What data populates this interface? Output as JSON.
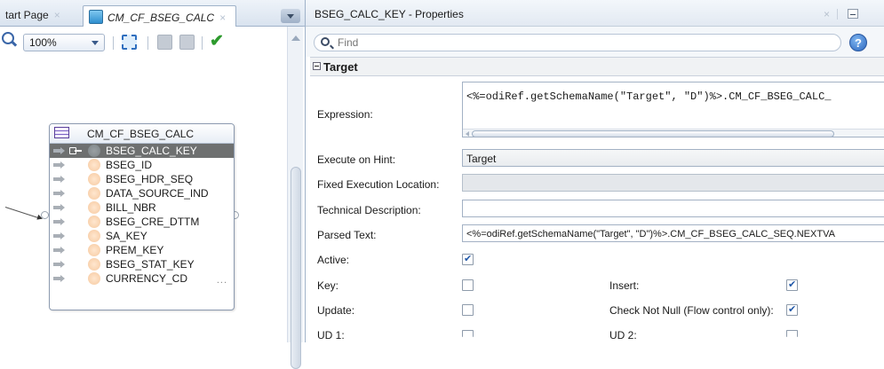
{
  "diagram_tabs": [
    {
      "label": "tart Page",
      "close": "×"
    },
    {
      "label": "CM_CF_BSEG_CALC",
      "close": "×"
    }
  ],
  "toolbar": {
    "zoom": "100%"
  },
  "entity": {
    "title": "CM_CF_BSEG_CALC",
    "attributes": [
      {
        "name": "BSEG_CALC_KEY",
        "selected": true
      },
      {
        "name": "BSEG_ID"
      },
      {
        "name": "BSEG_HDR_SEQ"
      },
      {
        "name": "DATA_SOURCE_IND"
      },
      {
        "name": "BILL_NBR"
      },
      {
        "name": "BSEG_CRE_DTTM"
      },
      {
        "name": "SA_KEY"
      },
      {
        "name": "PREM_KEY"
      },
      {
        "name": "BSEG_STAT_KEY"
      },
      {
        "name": "CURRENCY_CD"
      }
    ],
    "more": "..."
  },
  "properties": {
    "title": "BSEG_CALC_KEY - Properties",
    "close": "×",
    "find_placeholder": "Find",
    "help": "?",
    "section": "Target",
    "expression_label": "Expression:",
    "expression": "<%=odiRef.getSchemaName(\"Target\", \"D\")%>.CM_CF_BSEG_CALC_",
    "execute_on_hint_label": "Execute on Hint:",
    "execute_on_hint": "Target",
    "fixed_exec_label": "Fixed Execution Location:",
    "fixed_exec": "",
    "tech_desc_label": "Technical Description:",
    "tech_desc": "",
    "parsed_text_label": "Parsed Text:",
    "parsed_text": "<%=odiRef.getSchemaName(\"Target\", \"D\")%>.CM_CF_BSEG_CALC_SEQ.NEXTVA",
    "active_label": "Active:",
    "active": true,
    "key_label": "Key:",
    "key": false,
    "insert_label": "Insert:",
    "insert": true,
    "update_label": "Update:",
    "update": false,
    "check_not_null_label": "Check Not Null (Flow control only):",
    "check_not_null": true,
    "ud1_label": "UD 1:",
    "ud1": false,
    "ud2_label": "UD 2:",
    "ud2": false
  },
  "colors": {
    "accent": "#2158a8",
    "selected_row": "#6e7070",
    "check_green": "#2d9a2d"
  },
  "icons": [
    "zoom-icon",
    "fit-icon",
    "grid-icon",
    "auto-layout-icon",
    "validate-check-icon",
    "entity-table-icon",
    "primary-key-icon",
    "column-icon",
    "search-icon",
    "help-icon"
  ]
}
